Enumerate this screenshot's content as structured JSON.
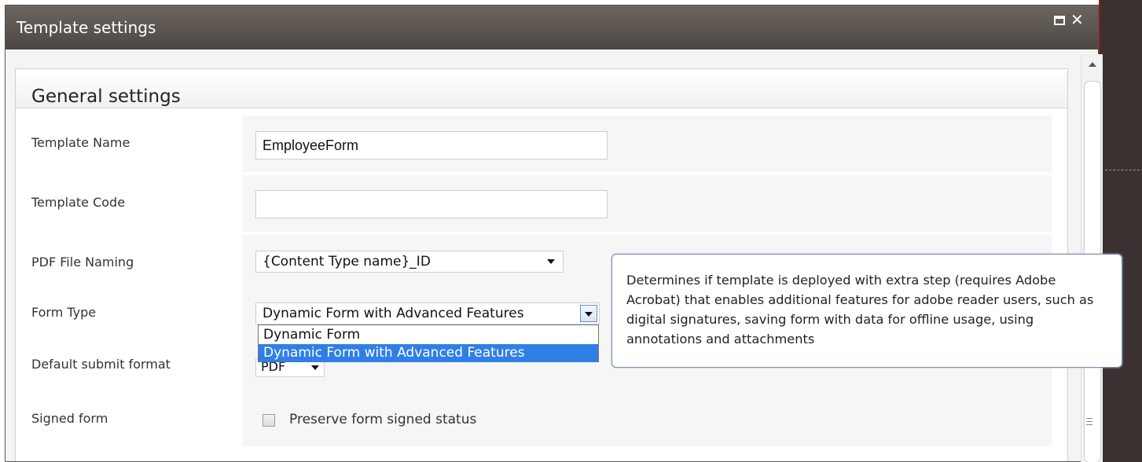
{
  "window": {
    "title": "Template settings",
    "maximize_icon": "maximize-icon",
    "close_glyph": "✕"
  },
  "section": {
    "title": "General settings"
  },
  "fields": {
    "template_name": {
      "label": "Template Name",
      "value": "EmployeeForm"
    },
    "template_code": {
      "label": "Template Code",
      "value": ""
    },
    "pdf_file_naming": {
      "label": "PDF File Naming",
      "value": "{Content Type name}_ID"
    },
    "form_type": {
      "label": "Form Type",
      "value": "Dynamic Form with Advanced Features",
      "options": [
        "Dynamic Form",
        "Dynamic Form with Advanced Features"
      ]
    },
    "default_submit_format": {
      "label": "Default submit format",
      "value": "PDF"
    },
    "signed_form": {
      "label": "Signed form",
      "checkbox_label": "Preserve form signed status",
      "checked": false
    }
  },
  "tooltip": {
    "text": "Determines if template is deployed with extra step (requires Adobe Acrobat) that enables additional features for adobe reader users, such as digital signatures, saving form with data for offline usage, using annotations and attachments"
  },
  "colors": {
    "titlebar": "#5a534f",
    "selection": "#2f7fe6",
    "accent_border": "#8c1c1c"
  }
}
